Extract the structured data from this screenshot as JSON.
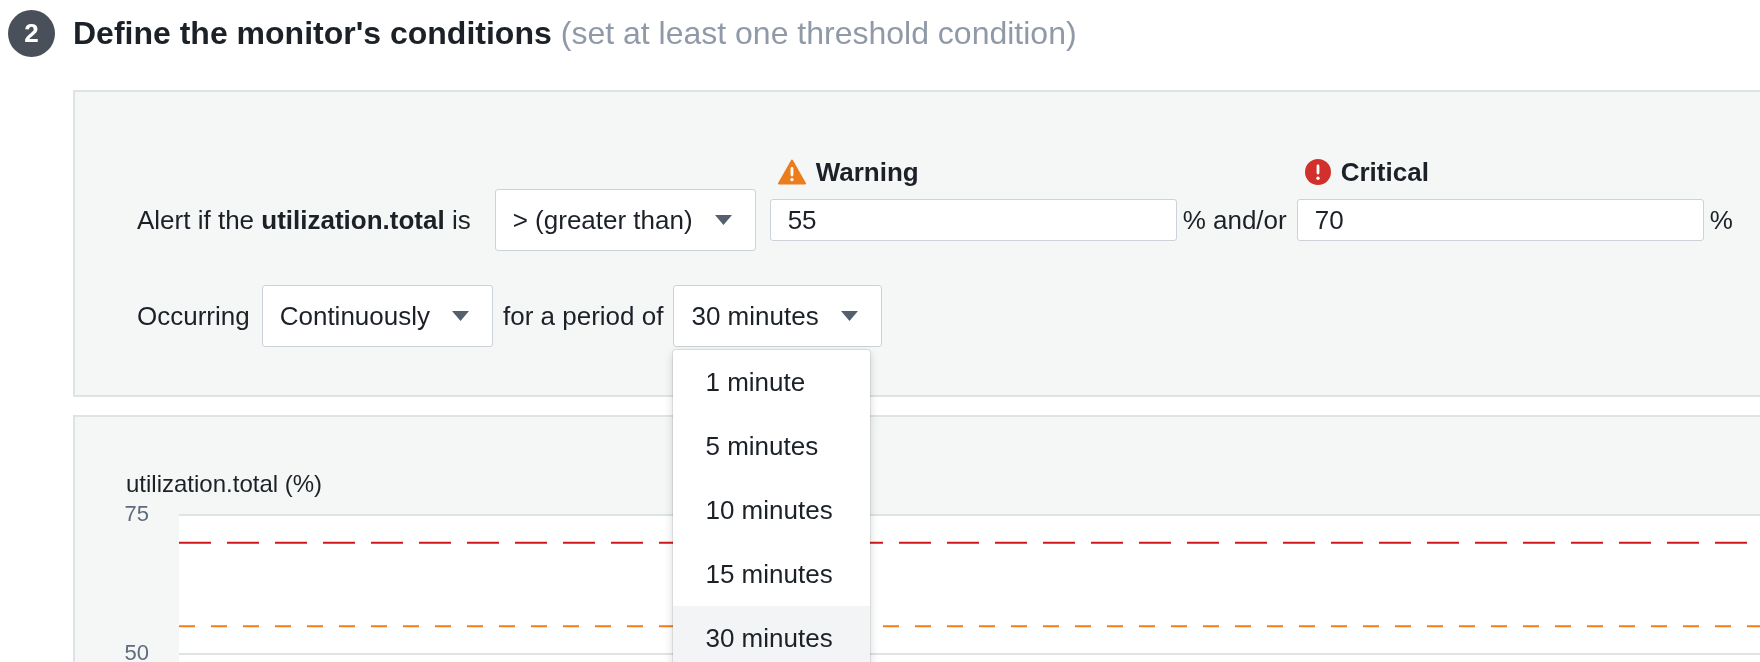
{
  "step": {
    "number": "2",
    "title": "Define the monitor's conditions",
    "hint": "(set at least one threshold condition)"
  },
  "conditions": {
    "alert_text": "Alert if the **utilization.total** is",
    "comparator": {
      "value": "> (greater than)"
    },
    "thresholds": [
      {
        "kind": "warning",
        "label": "Warning",
        "value": "55",
        "unit": "% and/or"
      },
      {
        "kind": "critical",
        "label": "Critical",
        "value": "70",
        "unit": "%"
      }
    ],
    "occurring_label": "Occurring",
    "occurrence": {
      "value": "Continuously"
    },
    "period_label": "for a period of",
    "period": {
      "value": "30 minutes",
      "expanded": true,
      "options": [
        {
          "label": "1 minute",
          "selected": false
        },
        {
          "label": "5 minutes",
          "selected": false
        },
        {
          "label": "10 minutes",
          "selected": false
        },
        {
          "label": "15 minutes",
          "selected": false
        },
        {
          "label": "30 minutes",
          "selected": true
        }
      ]
    }
  },
  "chart": {
    "chart_data": {
      "type": "line",
      "ylabel": "utilization.total (%)",
      "categories": [
        null
      ],
      "ylim": [
        48,
        75
      ],
      "yticks": [
        50,
        75
      ],
      "ref_lines": [
        {
          "axis": "y",
          "value": 70,
          "color": "#d0191b"
        },
        {
          "axis": "y",
          "value": 55,
          "color": "#ee7d1b"
        }
      ]
    }
  }
}
